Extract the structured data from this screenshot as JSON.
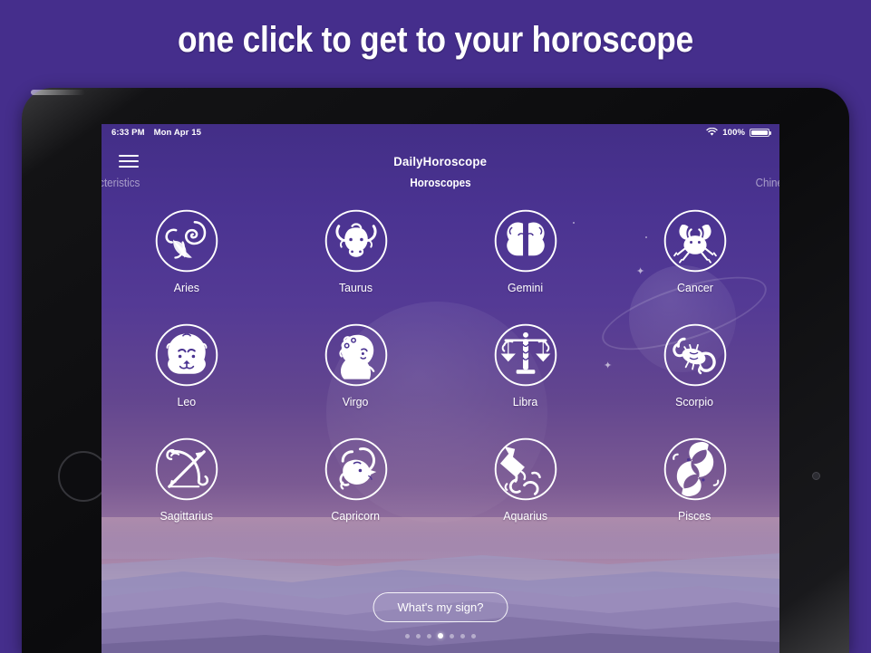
{
  "promo": {
    "title": "one click to get to your horoscope"
  },
  "device": {
    "type": "tablet",
    "orientation": "landscape"
  },
  "statusbar": {
    "time": "6:33 PM",
    "date": "Mon Apr 15",
    "wifi_icon": "wifi-icon",
    "battery_percent": "100%",
    "battery_icon": "battery-full-icon"
  },
  "navbar": {
    "menu_icon": "hamburger-menu-icon",
    "app_title": "DailyHoroscope"
  },
  "tabs": {
    "previous": "aracteristics",
    "current": "Horoscopes",
    "next": "Chinese"
  },
  "signs": [
    {
      "name": "Aries",
      "icon": "aries-ram-icon"
    },
    {
      "name": "Taurus",
      "icon": "taurus-bull-icon"
    },
    {
      "name": "Gemini",
      "icon": "gemini-twins-icon"
    },
    {
      "name": "Cancer",
      "icon": "cancer-crab-icon"
    },
    {
      "name": "Leo",
      "icon": "leo-lion-icon"
    },
    {
      "name": "Virgo",
      "icon": "virgo-maiden-icon"
    },
    {
      "name": "Libra",
      "icon": "libra-scales-icon"
    },
    {
      "name": "Scorpio",
      "icon": "scorpio-scorpion-icon"
    },
    {
      "name": "Sagittarius",
      "icon": "sagittarius-archer-icon"
    },
    {
      "name": "Capricorn",
      "icon": "capricorn-goat-icon"
    },
    {
      "name": "Aquarius",
      "icon": "aquarius-waterbearer-icon"
    },
    {
      "name": "Pisces",
      "icon": "pisces-fish-icon"
    }
  ],
  "cta": {
    "label": "What's my sign?"
  },
  "pager": {
    "total": 7,
    "active_index": 3
  },
  "colors": {
    "outer_background": "#452e8c",
    "screen_top": "#432e87",
    "screen_mid": "#63468f",
    "screen_bottom": "#b6a3c2",
    "accent_white": "#ffffff",
    "device_bezel": "#0b0b0d"
  }
}
